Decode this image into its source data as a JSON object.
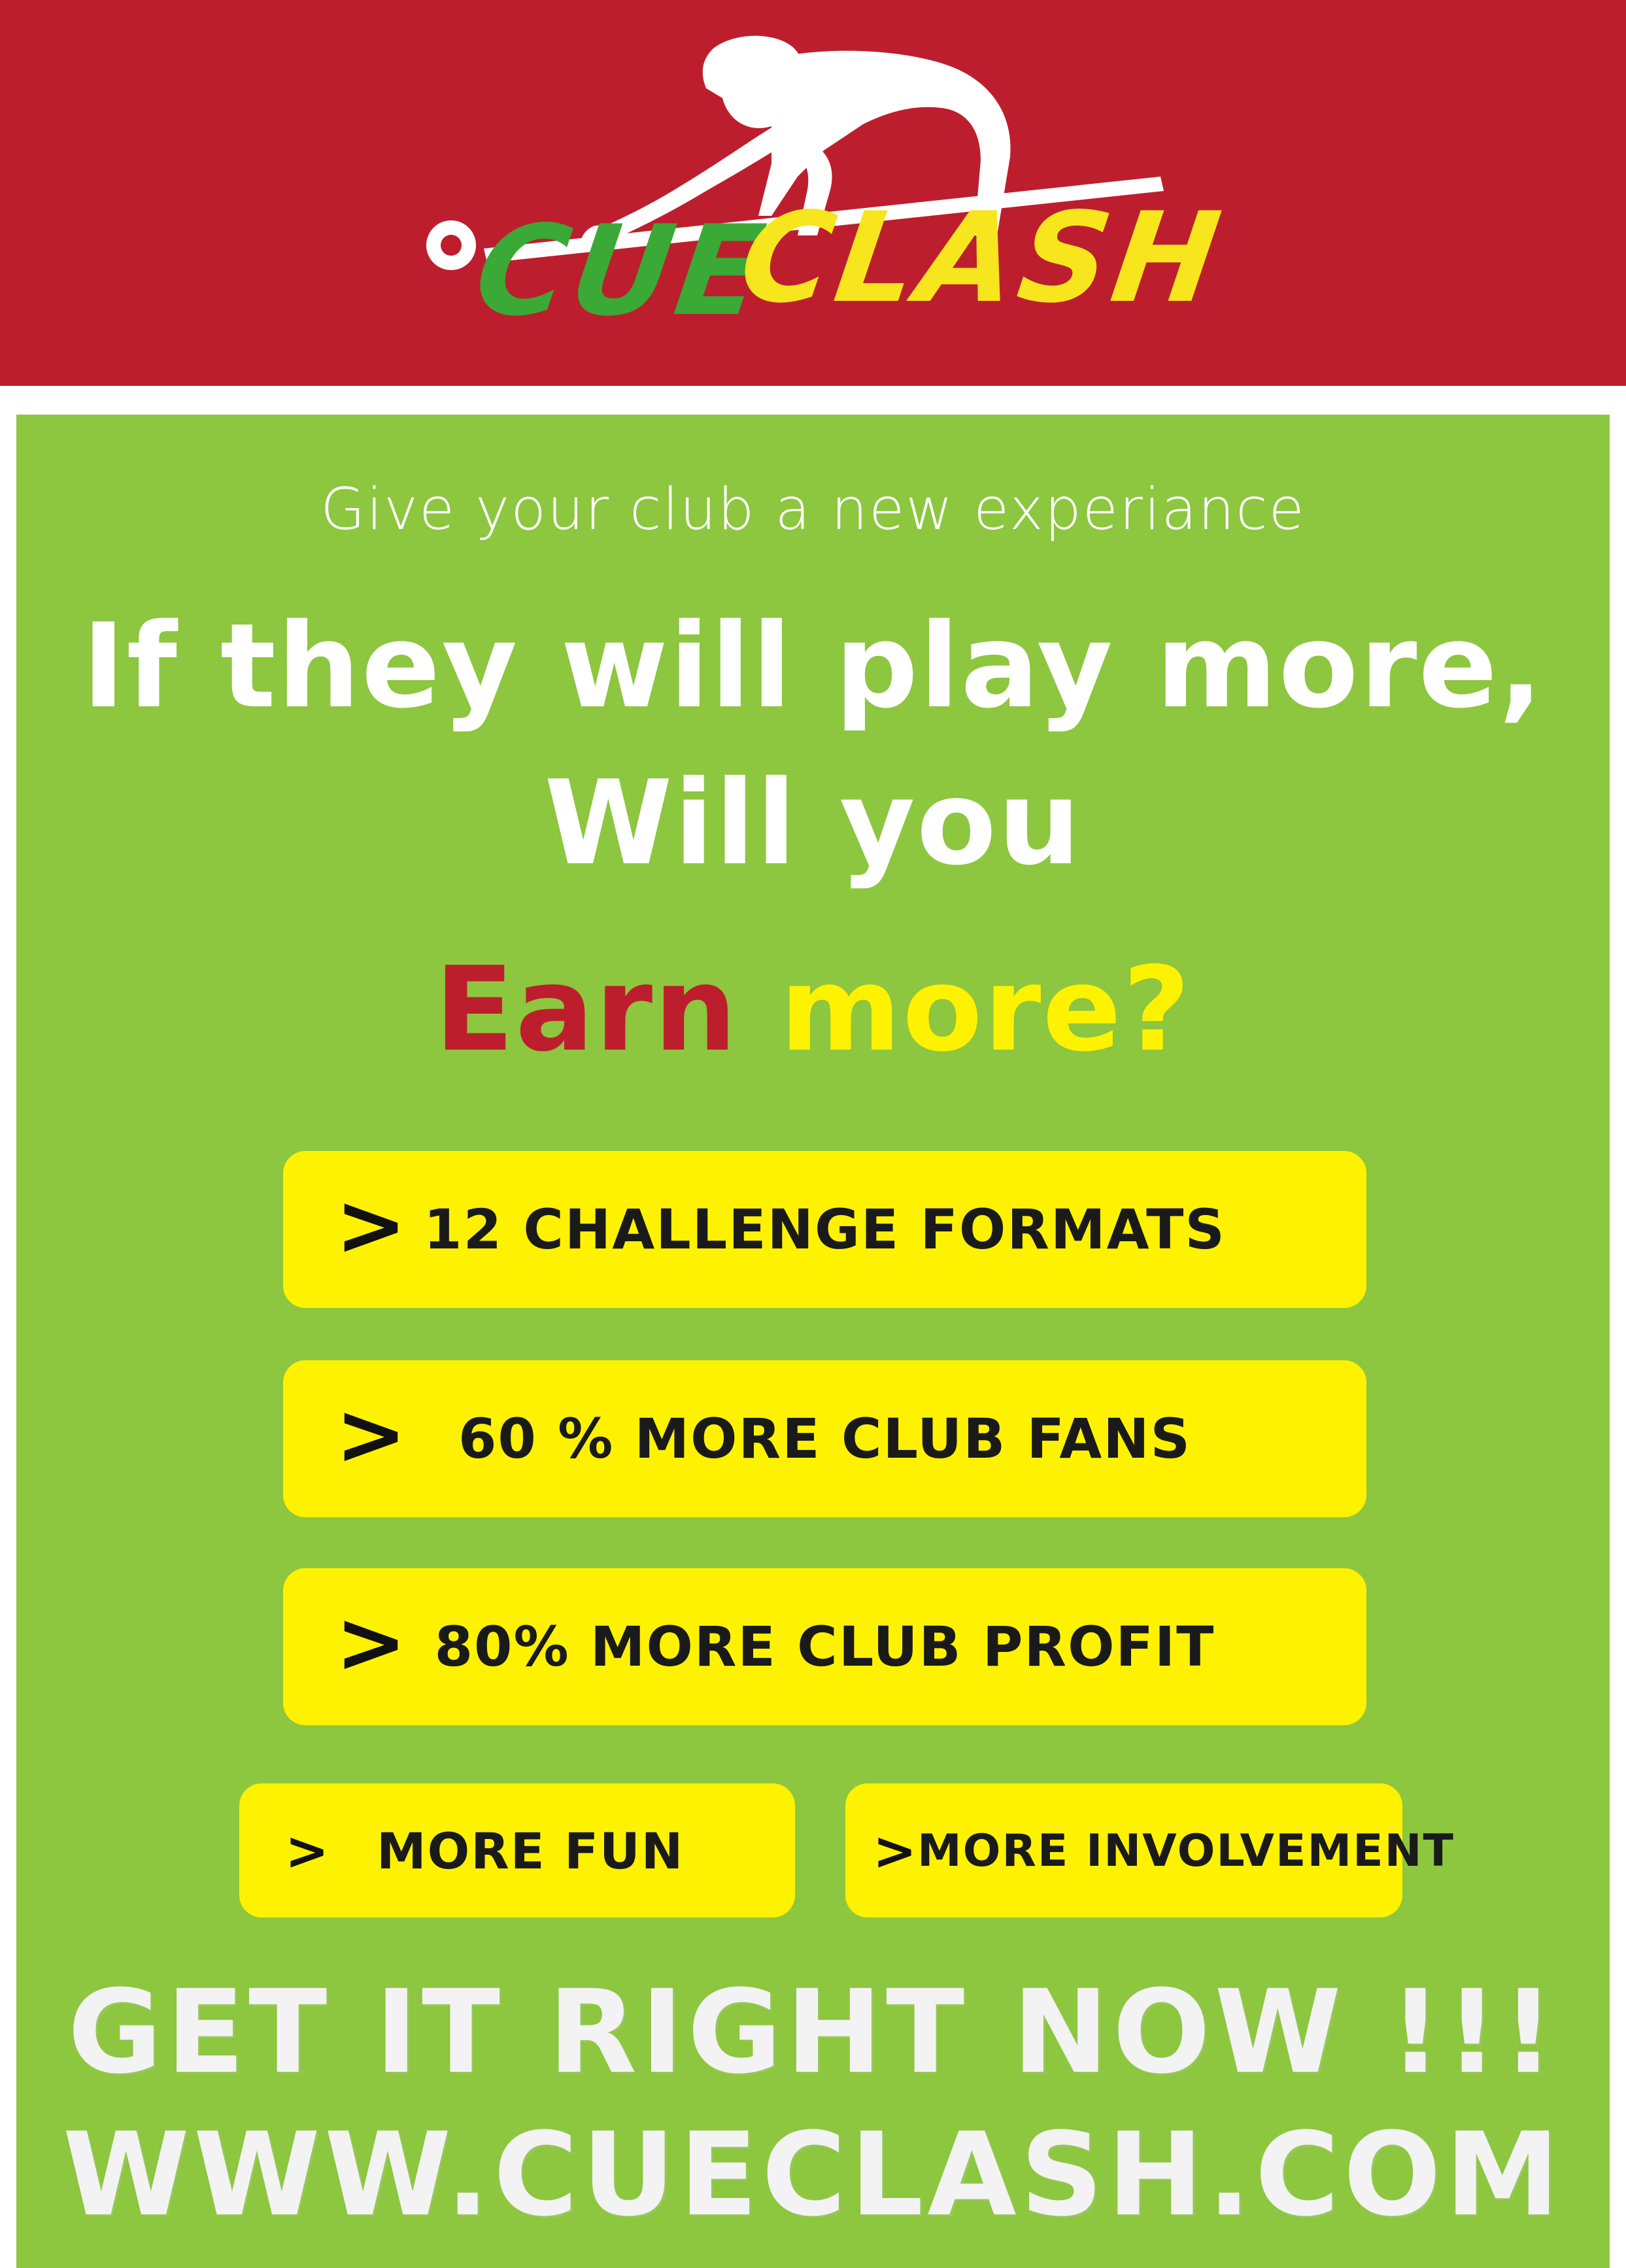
{
  "logo": {
    "word1": "CUE",
    "word2": "CLASH",
    "icon": "pool-player-silhouette-icon"
  },
  "tagline": "Give your club a new experiance",
  "headline": {
    "line1": "If they will play more,",
    "line2": "Will you",
    "earn": "Earn",
    "more": "more?"
  },
  "features": [
    {
      "chevron": ">",
      "label": "12 CHALLENGE FORMATS"
    },
    {
      "chevron": ">",
      "label": "60 % MORE CLUB FANS"
    },
    {
      "chevron": ">",
      "label": "80% MORE CLUB PROFIT"
    },
    {
      "chevron": ">",
      "label": "MORE FUN"
    },
    {
      "chevron": ">",
      "label": "MORE INVOLVEMENT"
    }
  ],
  "cta": {
    "line1": "GET IT RIGHT NOW !!!",
    "line2": "WWW.CUECLASH.COM"
  },
  "colors": {
    "header_red": "#bd1e2d",
    "panel_green": "#8dc63f",
    "pill_yellow": "#fff200",
    "logo_green": "#3aa935",
    "logo_yellow": "#f7e51e"
  }
}
